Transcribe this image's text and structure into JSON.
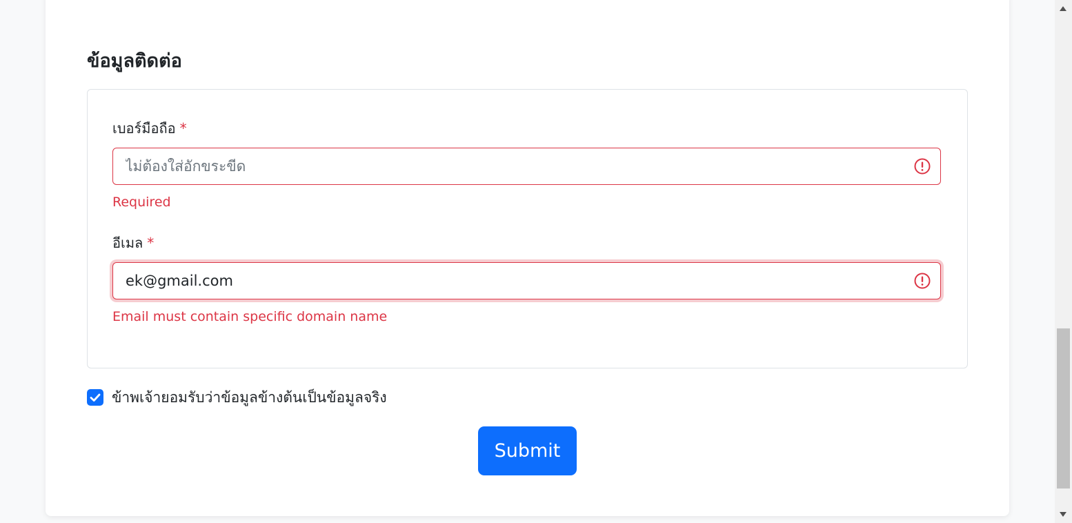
{
  "section": {
    "title": "ข้อมูลติดต่อ"
  },
  "phone": {
    "label": "เบอร์มือถือ",
    "required_mark": "*",
    "placeholder": "ไม่ต้องใส่อักขระขีด",
    "value": "",
    "error": "Required"
  },
  "email": {
    "label": "อีเมล",
    "required_mark": "*",
    "value": "ek@gmail.com",
    "error": "Email must contain specific domain name"
  },
  "consent": {
    "label": "ข้าพเจ้ายอมรับว่าข้อมูลข้างต้นเป็นข้อมูลจริง",
    "checked": true
  },
  "actions": {
    "submit_label": "Submit"
  },
  "colors": {
    "primary": "#0d6efd",
    "danger": "#dc3545",
    "border": "#dee2e6"
  },
  "icons": {
    "field_error": "exclamation-circle-icon",
    "checkbox": "checkmark-icon"
  }
}
